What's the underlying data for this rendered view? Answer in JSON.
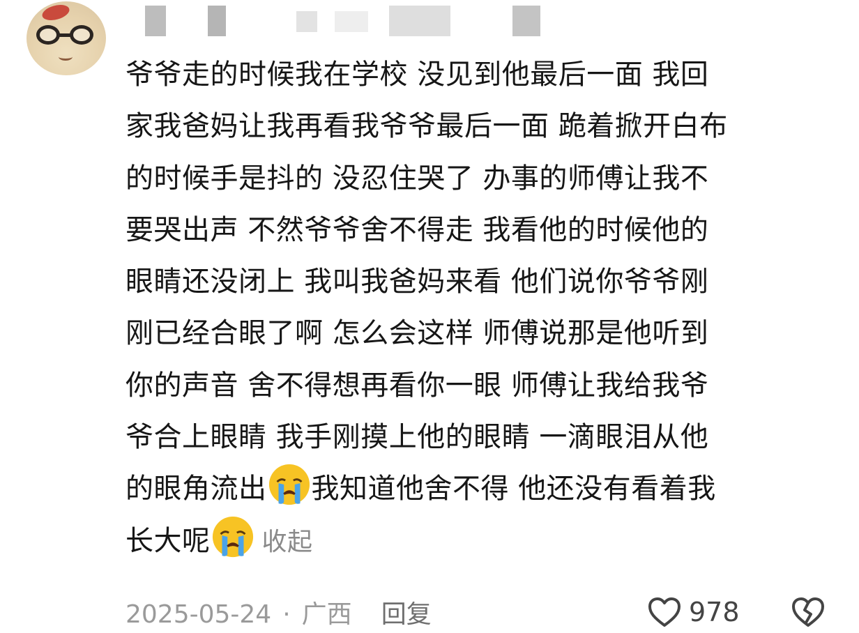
{
  "comment": {
    "lines": [
      "爷爷走的时候我在学校 没见到他最后一面 我回",
      "家我爸妈让我再看我爷爷最后一面 跪着掀开白布",
      "的时候手是抖的 没忍住哭了 办事的师傅让我不",
      "要哭出声 不然爷爷舍不得走 我看他的时候他的",
      "眼睛还没闭上 我叫我爸妈来看 他们说你爷爷刚",
      "刚已经合眼了啊 怎么会这样 师傅说那是他听到",
      "你的声音 舍不得想再看你一眼 师傅让我给我爷",
      "爷合上眼睛 我手刚摸上他的眼睛 一滴眼泪从他"
    ],
    "line9_a": "的眼角流出",
    "line9_b": "我知道他舍不得 他还没有看着我",
    "line10": "长大呢",
    "collapse_label": "收起",
    "emoji_name": "loudly-crying-face"
  },
  "footer": {
    "date": "2025-05-24",
    "separator": "·",
    "location": "广西",
    "reply_label": "回复",
    "like_count": "978"
  },
  "icons": {
    "like": "heart-outline-icon",
    "dislike": "broken-heart-icon"
  },
  "colors": {
    "text": "#161616",
    "muted": "#9a9a9a",
    "emoji": "#f7c324"
  }
}
